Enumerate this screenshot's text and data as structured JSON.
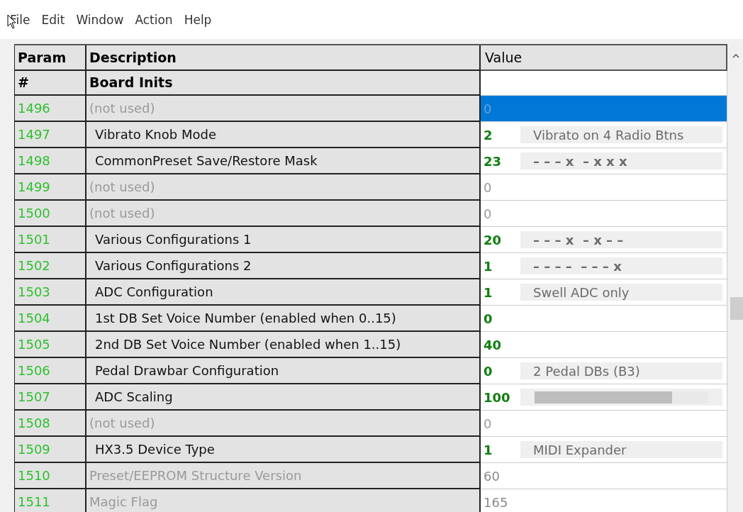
{
  "menu": [
    {
      "label": "File"
    },
    {
      "label": "Edit"
    },
    {
      "label": "Window"
    },
    {
      "label": "Action"
    },
    {
      "label": "Help"
    }
  ],
  "table": {
    "columns": [
      "Param",
      "Description",
      "Value"
    ],
    "section": {
      "param": "#",
      "description": "Board Inits"
    },
    "rows": [
      {
        "param": "1496",
        "kind": "unused",
        "description": "(not used)",
        "value": "0",
        "selected": true
      },
      {
        "param": "1497",
        "kind": "param",
        "description": "Vibrato Knob Mode",
        "value": "2",
        "info": {
          "kind": "text",
          "text": "Vibrato on 4 Radio Btns"
        },
        "selected": false
      },
      {
        "param": "1498",
        "kind": "param",
        "description": "CommonPreset Save/Restore Mask",
        "value": "23",
        "info": {
          "kind": "mask",
          "text": "– – – x  – x x x"
        },
        "selected": false
      },
      {
        "param": "1499",
        "kind": "unused",
        "description": "(not used)",
        "value": "0",
        "selected": false
      },
      {
        "param": "1500",
        "kind": "unused",
        "description": "(not used)",
        "value": "0",
        "selected": false
      },
      {
        "param": "1501",
        "kind": "param",
        "description": "Various Configurations 1",
        "value": "20",
        "info": {
          "kind": "mask",
          "text": "– – – x  – x – –"
        },
        "selected": false
      },
      {
        "param": "1502",
        "kind": "param",
        "description": "Various Configurations 2",
        "value": "1",
        "info": {
          "kind": "mask",
          "text": "– – – –  – – – x"
        },
        "selected": false
      },
      {
        "param": "1503",
        "kind": "param",
        "description": "ADC Configuration",
        "value": "1",
        "info": {
          "kind": "text",
          "text": "Swell ADC only"
        },
        "selected": false
      },
      {
        "param": "1504",
        "kind": "param",
        "description": "1st DB Set Voice Number (enabled when 0..15)",
        "value": "0",
        "selected": false
      },
      {
        "param": "1505",
        "kind": "param",
        "description": "2nd DB Set Voice Number (enabled when 1..15)",
        "value": "40",
        "selected": false
      },
      {
        "param": "1506",
        "kind": "param",
        "description": "Pedal Drawbar Configuration",
        "value": "0",
        "info": {
          "kind": "text",
          "text": "2 Pedal DBs (B3)"
        },
        "selected": false
      },
      {
        "param": "1507",
        "kind": "param",
        "description": "ADC Scaling",
        "value": "100",
        "info": {
          "kind": "bar",
          "level": 0.79
        },
        "selected": false
      },
      {
        "param": "1508",
        "kind": "unused",
        "description": "(not used)",
        "value": "0",
        "selected": false
      },
      {
        "param": "1509",
        "kind": "param",
        "description": "HX3.5 Device Type",
        "value": "1",
        "info": {
          "kind": "text",
          "text": "MIDI Expander"
        },
        "selected": false
      },
      {
        "param": "1510",
        "kind": "readonly",
        "description": "Preset/EEPROM Structure Version",
        "value": "60",
        "selected": false
      },
      {
        "param": "1511",
        "kind": "readonly",
        "description": "Magic Flag",
        "value": "165",
        "selected": false
      }
    ]
  }
}
